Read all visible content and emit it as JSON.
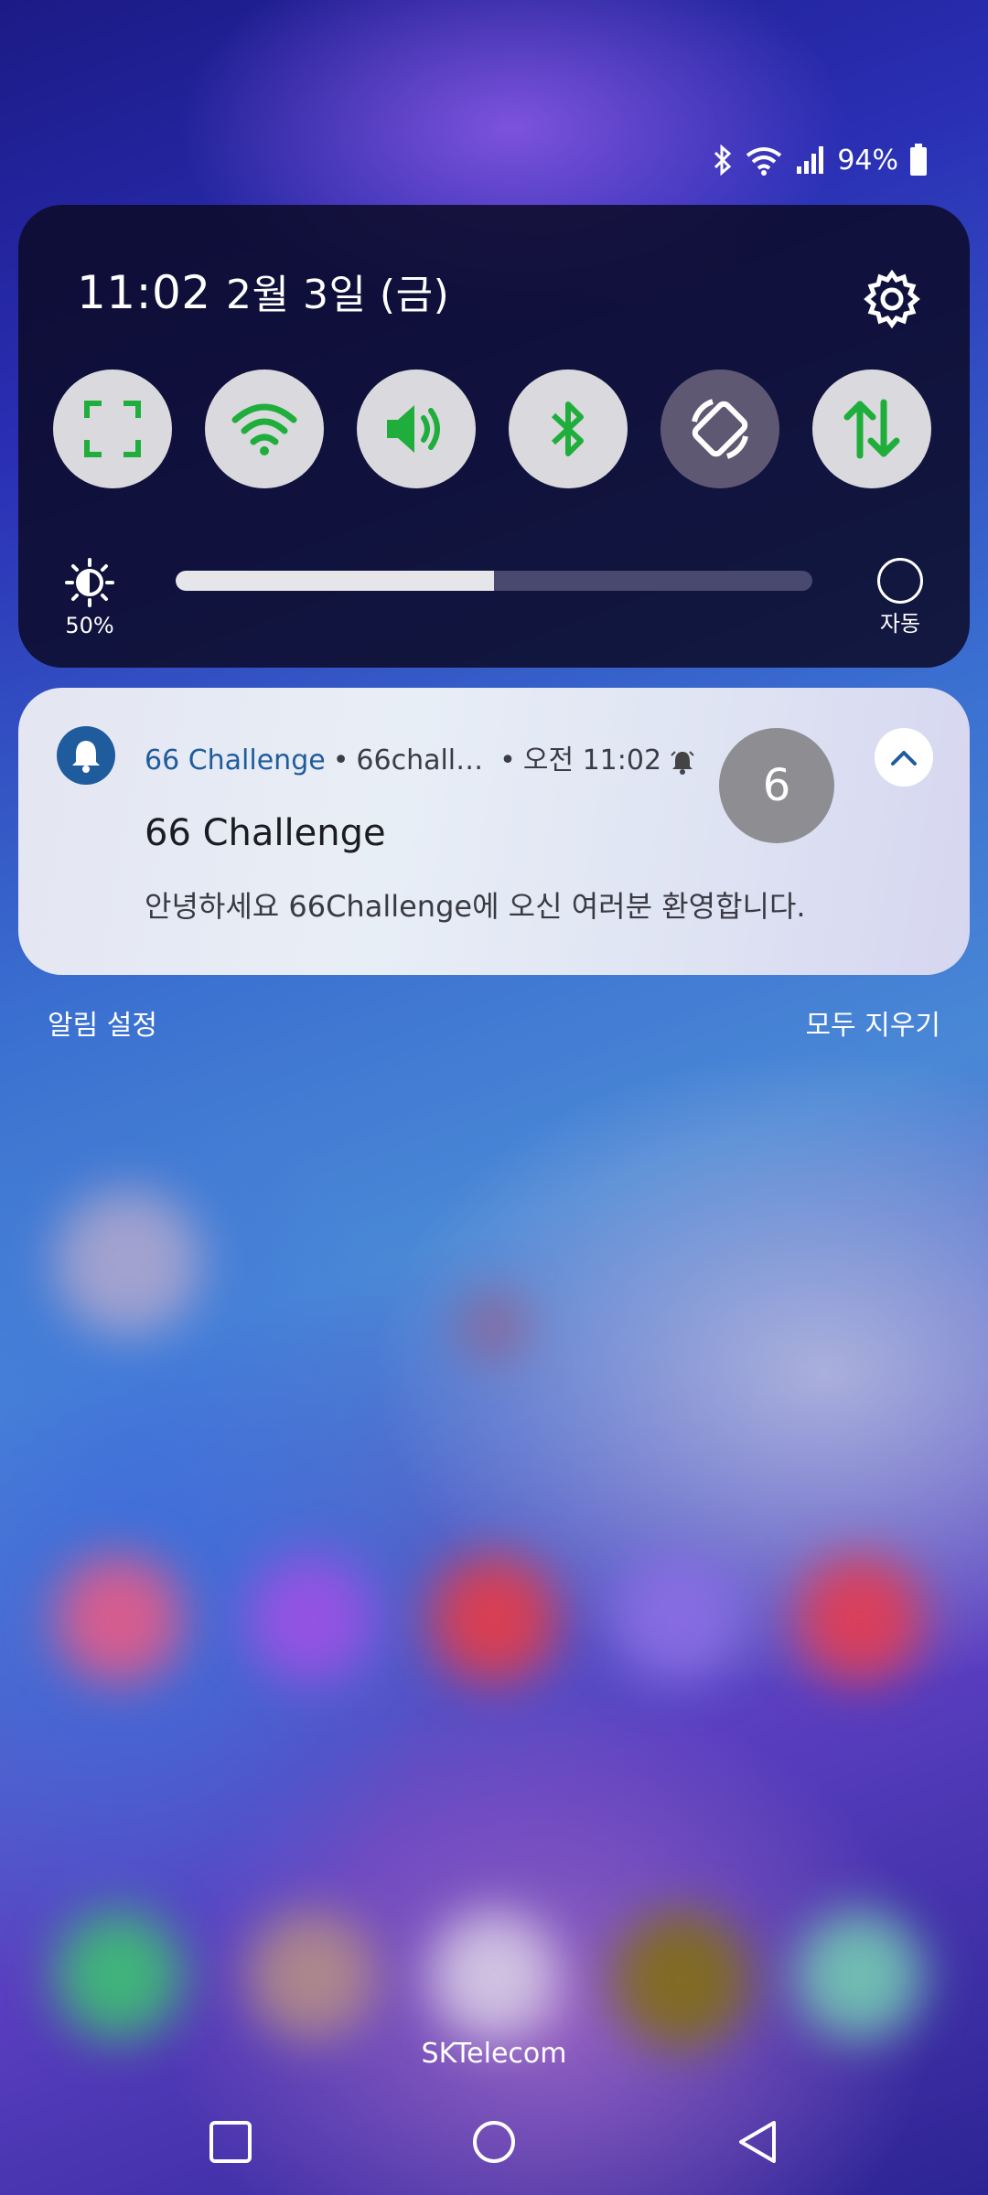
{
  "status_bar": {
    "battery": "94%"
  },
  "quick_settings": {
    "time": "11:02",
    "date": "2월 3일 (금)",
    "tiles": [
      {
        "name": "screen-capture",
        "active": true
      },
      {
        "name": "wifi",
        "active": true
      },
      {
        "name": "sound",
        "active": true
      },
      {
        "name": "bluetooth",
        "active": true
      },
      {
        "name": "auto-rotate",
        "active": false
      },
      {
        "name": "mobile-data",
        "active": true
      }
    ],
    "brightness_label": "50%",
    "brightness_level": 0.5,
    "auto_label": "자동"
  },
  "notification": {
    "app_name": "66 Challenge",
    "sub_text": "66chall…",
    "time": "오전 11:02",
    "badge": "6",
    "title": "66 Challenge",
    "body": "안녕하세요 66Challenge에 오신 여러분 환영합니다."
  },
  "footer": {
    "settings_label": "알림 설정",
    "clear_label": "모두 지우기",
    "carrier": "SKTelecom"
  },
  "colors": {
    "accent_green": "#1fae3b",
    "app_blue": "#1f5c9e"
  }
}
